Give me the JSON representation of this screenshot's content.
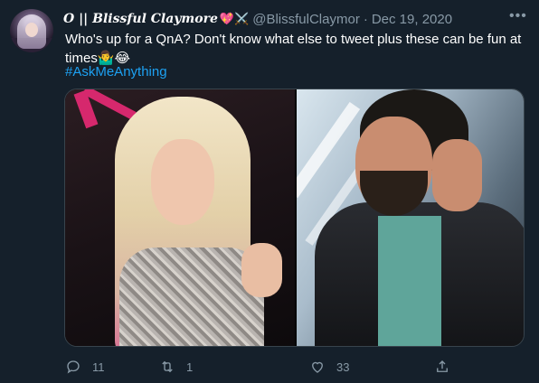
{
  "tweet": {
    "display_name": "O || Blissful Claymore",
    "display_name_emoji": "💖⚔️",
    "handle": "@BlissfulClaymor",
    "separator": "·",
    "date": "Dec 19, 2020",
    "text": "Who's up for a QnA? Don't know what else to tweet plus these can be fun at times🤷‍♂️😂",
    "hashtag": "#AskMeAnything",
    "more_icon": "more-options-icon",
    "actions": {
      "reply_count": "11",
      "retweet_count": "1",
      "like_count": "33",
      "share_count": ""
    }
  },
  "colors": {
    "background": "#15202b",
    "text_secondary": "#8899a6",
    "link": "#1da1f2",
    "border": "#38444d"
  }
}
